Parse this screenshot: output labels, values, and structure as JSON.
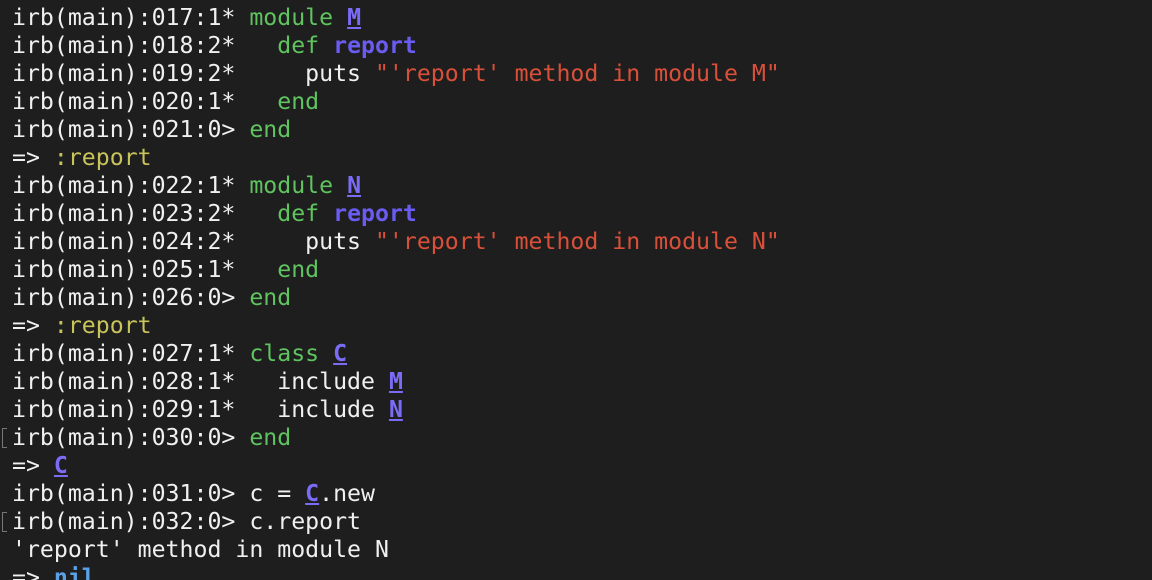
{
  "terminal": {
    "lines": [
      {
        "prompt": "irb(main):017:1* ",
        "kw": "module",
        "const": "M"
      },
      {
        "prompt": "irb(main):018:2* ",
        "kw": "  def",
        "meth": "report"
      },
      {
        "prompt": "irb(main):019:2* ",
        "txt": "    puts ",
        "str": "\"'report' method in module M\""
      },
      {
        "prompt": "irb(main):020:1* ",
        "kw": "  end"
      },
      {
        "prompt": "irb(main):021:0> ",
        "kw": "end"
      },
      {
        "arrow": "=> ",
        "sym": ":report"
      },
      {
        "prompt": "irb(main):022:1* ",
        "kw": "module",
        "const": "N"
      },
      {
        "prompt": "irb(main):023:2* ",
        "kw": "  def",
        "meth": "report"
      },
      {
        "prompt": "irb(main):024:2* ",
        "txt": "    puts ",
        "str": "\"'report' method in module N\""
      },
      {
        "prompt": "irb(main):025:1* ",
        "kw": "  end"
      },
      {
        "prompt": "irb(main):026:0> ",
        "kw": "end"
      },
      {
        "arrow": "=> ",
        "sym": ":report"
      },
      {
        "prompt": "irb(main):027:1* ",
        "kw": "class",
        "const": "C"
      },
      {
        "prompt": "irb(main):028:1* ",
        "txt": "  include ",
        "const": "M"
      },
      {
        "prompt": "irb(main):029:1* ",
        "txt": "  include ",
        "const": "N"
      },
      {
        "prompt": "irb(main):030:0> ",
        "kw": "end"
      },
      {
        "arrow": "=> ",
        "const": "C"
      },
      {
        "prompt": "irb(main):031:0> ",
        "txt": "c = ",
        "const": "C",
        "txt2": ".new"
      },
      {
        "prompt": "irb(main):032:0> ",
        "txt": "c.report"
      },
      {
        "output": "'report' method in module N"
      },
      {
        "arrow": "=> ",
        "nil": "nil"
      }
    ]
  }
}
